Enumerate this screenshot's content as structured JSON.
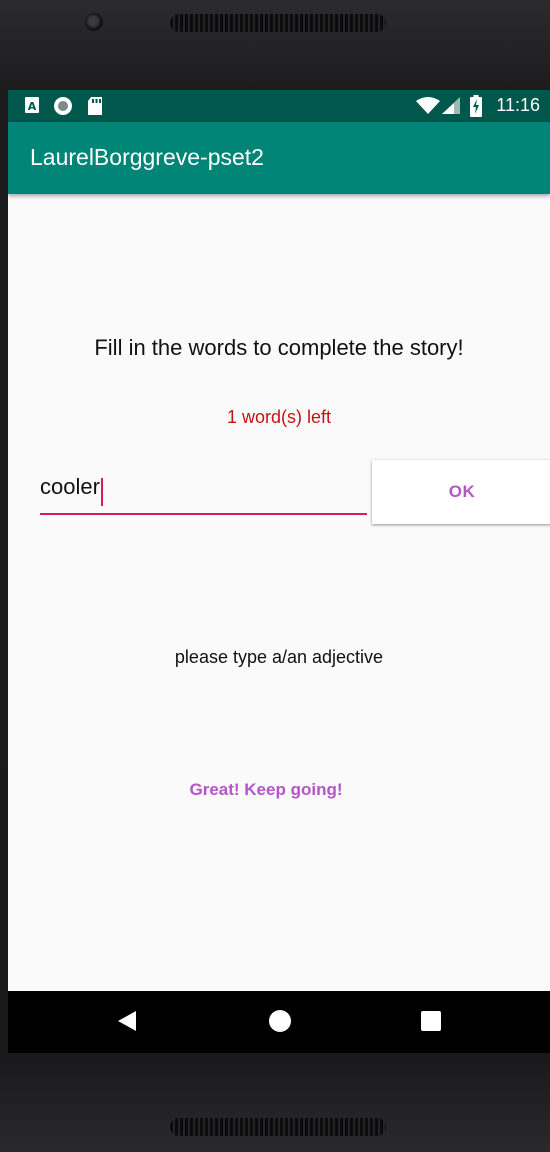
{
  "status_bar": {
    "time": "11:16",
    "left_icons": [
      "text-a-icon",
      "sync-circle-icon",
      "sd-card-icon"
    ],
    "right_icons": [
      "wifi-icon",
      "cell-signal-icon",
      "battery-charging-icon"
    ]
  },
  "app_bar": {
    "title": "LaurelBorggreve-pset2",
    "color": "#008577",
    "status_color": "#00574b"
  },
  "main": {
    "prompt": "Fill in the words to complete the story!",
    "words_left": "1 word(s) left",
    "input_value": "cooler",
    "ok_label": "OK",
    "hint": "please type a/an adjective",
    "encouragement": "Great! Keep going!"
  },
  "nav_bar": {
    "buttons": [
      "back-icon",
      "home-icon",
      "recents-icon"
    ]
  },
  "colors": {
    "accent": "#d81b60",
    "button_text": "#b455c8",
    "warning_text": "#c41411"
  }
}
